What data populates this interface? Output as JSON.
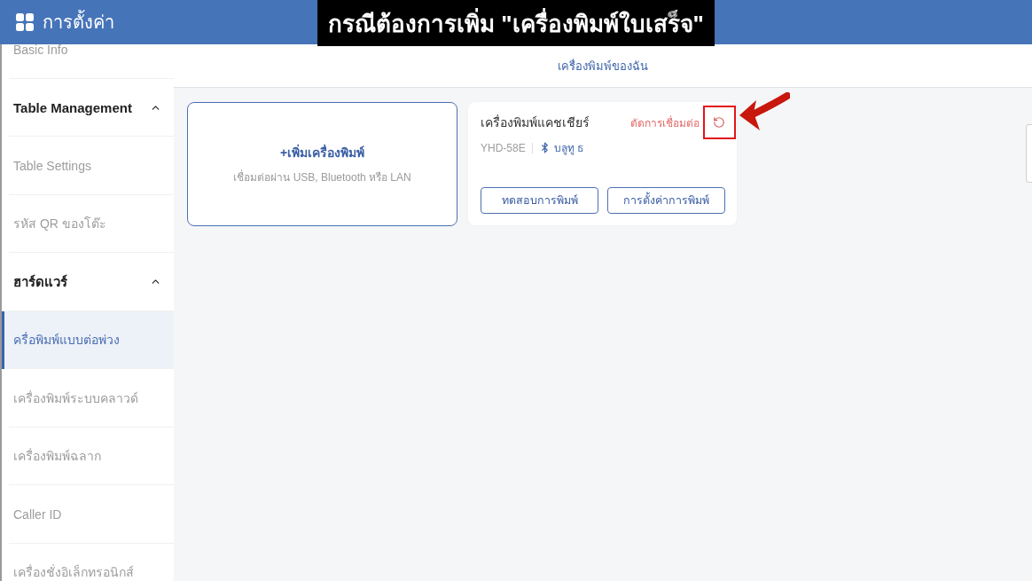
{
  "header": {
    "title": "การตั้งค่า"
  },
  "caption": "กรณีต้องการเพิ่ม \"เครื่องพิมพ์ใบเสร็จ\"",
  "sidebar": {
    "groups": [
      {
        "items": [
          {
            "label": "Basic Info",
            "selected": false
          }
        ]
      },
      {
        "title": "Table Management",
        "expanded": true,
        "items": [
          {
            "label": "Table Settings",
            "selected": false
          },
          {
            "label": "รหัส QR ของโต๊ะ",
            "selected": false
          }
        ]
      },
      {
        "title": "ฮาร์ดแวร์",
        "expanded": true,
        "items": [
          {
            "label": "ครื่อพิมพ์แบบต่อพ่วง",
            "selected": true
          },
          {
            "label": "เครื่องพิมพ์ระบบคลาวด์",
            "selected": false
          },
          {
            "label": "เครื่องพิมพ์ฉลาก",
            "selected": false
          },
          {
            "label": "Caller ID",
            "selected": false
          },
          {
            "label": "เครื่องชั่งอิเล็กทรอนิกส์",
            "selected": false
          }
        ]
      }
    ]
  },
  "tabs": [
    {
      "label": "เครื่องพิมพ์ของฉัน",
      "selected": true
    }
  ],
  "add_card": {
    "title": "+เพิ่มเครื่องพิมพ์",
    "subtitle": "เชื่อมต่อผ่าน USB, Bluetooth หรือ LAN"
  },
  "printers": [
    {
      "name": "เครื่องพิมพ์แคชเชียร์",
      "action": "ตัดการเชื่อมต่อ",
      "model": "YHD-58E",
      "connection": {
        "kind": "bluetooth",
        "label": "บลูทู ธ"
      },
      "buttons": [
        "ทดสอบการพิมพ์",
        "การตั้งค่าการพิมพ์"
      ]
    }
  ]
}
